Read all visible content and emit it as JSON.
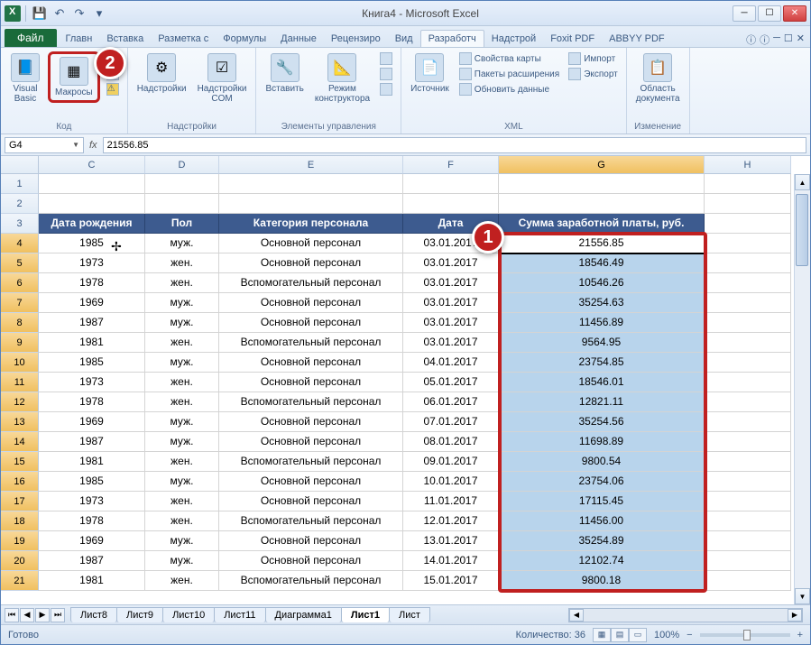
{
  "title": "Книга4 - Microsoft Excel",
  "qat": {
    "save": "💾",
    "undo": "↶",
    "redo": "↷"
  },
  "tabs": {
    "file": "Файл",
    "items": [
      "Главн",
      "Вставка",
      "Разметка с",
      "Формулы",
      "Данные",
      "Рецензиро",
      "Вид",
      "Разработч",
      "Надстрой",
      "Foxit PDF",
      "ABBYY PDF"
    ],
    "active": "Разработч"
  },
  "ribbon": {
    "group_code": "Код",
    "vb": "Visual\nBasic",
    "macros": "Макросы",
    "group_addins": "Надстройки",
    "addins": "Надстройки",
    "com": "Надстройки\nCOM",
    "group_controls": "Элементы управления",
    "insert": "Вставить",
    "designer": "Режим\nконструктора",
    "group_xml": "XML",
    "source": "Источник",
    "props": "Свойства карты",
    "expansion": "Пакеты расширения",
    "refresh": "Обновить данные",
    "import": "Импорт",
    "export": "Экспорт",
    "group_change": "Изменение",
    "docarea": "Область\nдокумента"
  },
  "namebox": "G4",
  "formula": "21556.85",
  "columns": [
    "C",
    "D",
    "E",
    "F",
    "G",
    "H"
  ],
  "header_row": [
    "Дата рождения",
    "Пол",
    "Категория персонала",
    "Дата",
    "Сумма заработной платы, руб."
  ],
  "rows": [
    {
      "n": 1,
      "empty": true
    },
    {
      "n": 2,
      "empty": true
    },
    {
      "n": 3,
      "header": true
    },
    {
      "n": 4,
      "c": "1985",
      "d": "муж.",
      "e": "Основной персонал",
      "f": "03.01.2017",
      "g": "21556.85"
    },
    {
      "n": 5,
      "c": "1973",
      "d": "жен.",
      "e": "Основной персонал",
      "f": "03.01.2017",
      "g": "18546.49"
    },
    {
      "n": 6,
      "c": "1978",
      "d": "жен.",
      "e": "Вспомогательный персонал",
      "f": "03.01.2017",
      "g": "10546.26"
    },
    {
      "n": 7,
      "c": "1969",
      "d": "муж.",
      "e": "Основной персонал",
      "f": "03.01.2017",
      "g": "35254.63"
    },
    {
      "n": 8,
      "c": "1987",
      "d": "муж.",
      "e": "Основной персонал",
      "f": "03.01.2017",
      "g": "11456.89"
    },
    {
      "n": 9,
      "c": "1981",
      "d": "жен.",
      "e": "Вспомогательный персонал",
      "f": "03.01.2017",
      "g": "9564.95"
    },
    {
      "n": 10,
      "c": "1985",
      "d": "муж.",
      "e": "Основной персонал",
      "f": "04.01.2017",
      "g": "23754.85"
    },
    {
      "n": 11,
      "c": "1973",
      "d": "жен.",
      "e": "Основной персонал",
      "f": "05.01.2017",
      "g": "18546.01"
    },
    {
      "n": 12,
      "c": "1978",
      "d": "жен.",
      "e": "Вспомогательный персонал",
      "f": "06.01.2017",
      "g": "12821.11"
    },
    {
      "n": 13,
      "c": "1969",
      "d": "муж.",
      "e": "Основной персонал",
      "f": "07.01.2017",
      "g": "35254.56"
    },
    {
      "n": 14,
      "c": "1987",
      "d": "муж.",
      "e": "Основной персонал",
      "f": "08.01.2017",
      "g": "11698.89"
    },
    {
      "n": 15,
      "c": "1981",
      "d": "жен.",
      "e": "Вспомогательный персонал",
      "f": "09.01.2017",
      "g": "9800.54"
    },
    {
      "n": 16,
      "c": "1985",
      "d": "муж.",
      "e": "Основной персонал",
      "f": "10.01.2017",
      "g": "23754.06"
    },
    {
      "n": 17,
      "c": "1973",
      "d": "жен.",
      "e": "Основной персонал",
      "f": "11.01.2017",
      "g": "17115.45"
    },
    {
      "n": 18,
      "c": "1978",
      "d": "жен.",
      "e": "Вспомогательный персонал",
      "f": "12.01.2017",
      "g": "11456.00"
    },
    {
      "n": 19,
      "c": "1969",
      "d": "муж.",
      "e": "Основной персонал",
      "f": "13.01.2017",
      "g": "35254.89"
    },
    {
      "n": 20,
      "c": "1987",
      "d": "муж.",
      "e": "Основной персонал",
      "f": "14.01.2017",
      "g": "12102.74"
    },
    {
      "n": 21,
      "c": "1981",
      "d": "жен.",
      "e": "Вспомогательный персонал",
      "f": "15.01.2017",
      "g": "9800.18"
    }
  ],
  "sheet_tabs": [
    "Лист8",
    "Лист9",
    "Лист10",
    "Лист11",
    "Диаграмма1",
    "Лист1",
    "Лист"
  ],
  "active_sheet": "Лист1",
  "status": {
    "ready": "Готово",
    "count_label": "Количество: 36",
    "zoom": "100%"
  },
  "markers": {
    "one": "1",
    "two": "2"
  }
}
